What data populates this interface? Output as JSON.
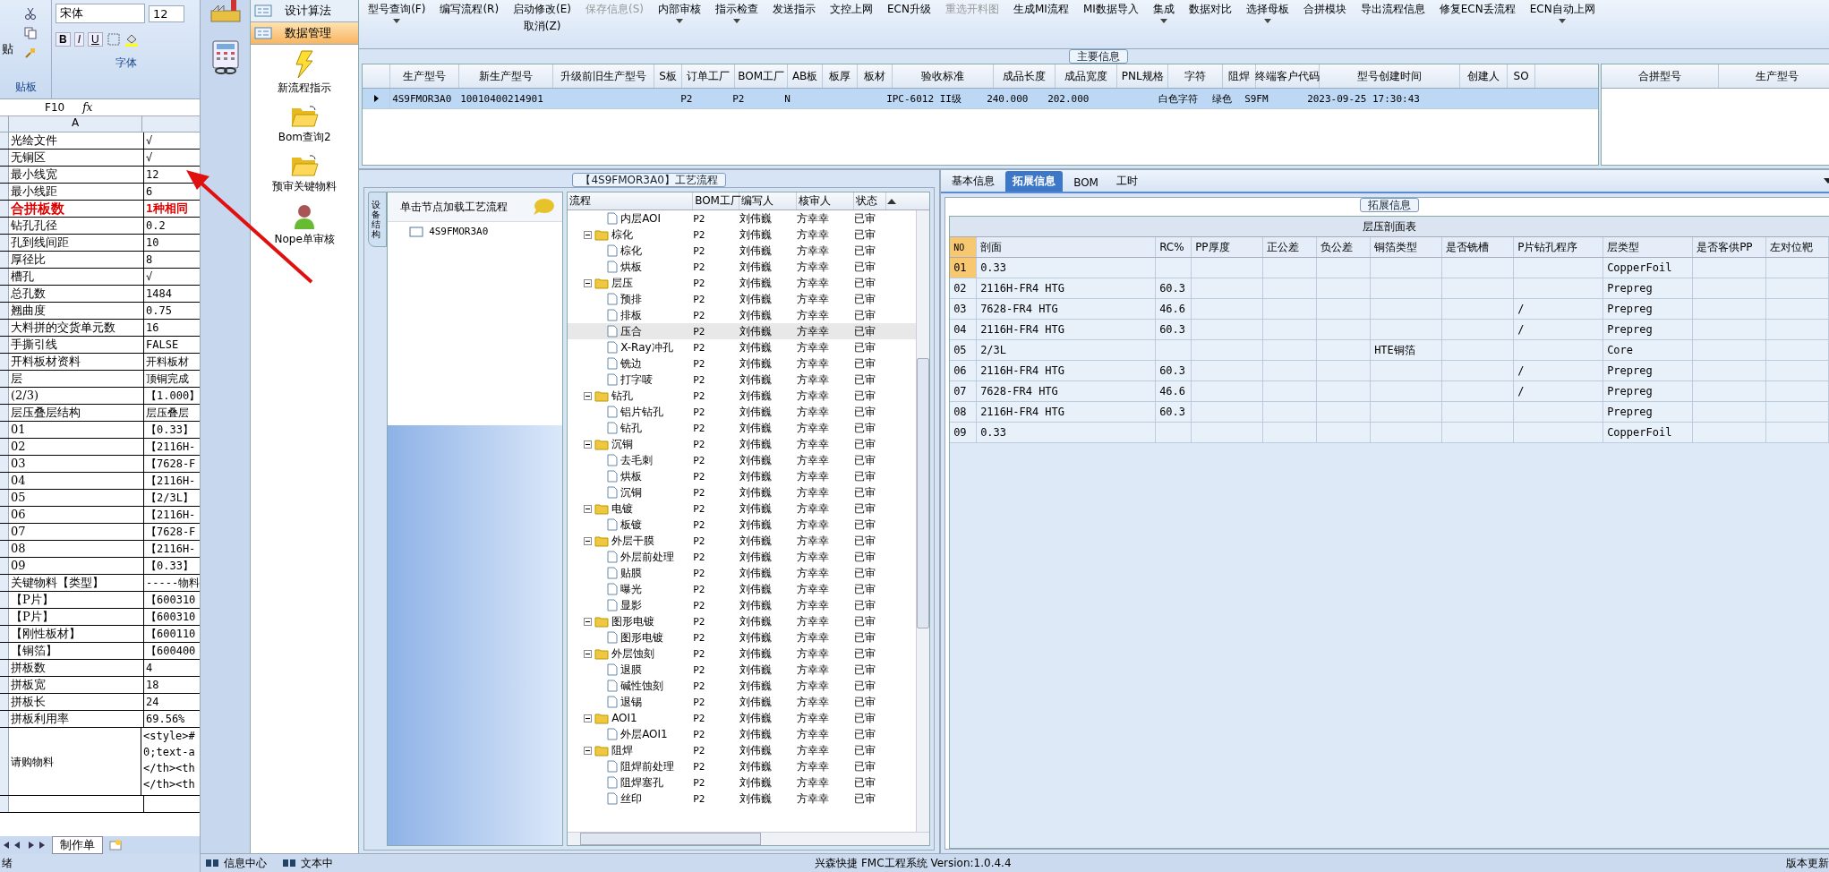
{
  "excel": {
    "paste": "贴",
    "clipboard_label": "贴板",
    "font_name": "宋体",
    "font_size": "12",
    "format_buttons": [
      "B",
      "I",
      "U"
    ],
    "font_label": "字体",
    "cell_ref": "F10",
    "fx": "fx",
    "column": "A",
    "rows": [
      {
        "label": "光绘文件",
        "value": "√",
        "emphasis": false
      },
      {
        "label": "无铜区",
        "value": "√",
        "emphasis": false
      },
      {
        "label": "最小线宽",
        "value": "12",
        "emphasis": false
      },
      {
        "label": "最小线距",
        "value": "6",
        "emphasis": false
      },
      {
        "label": "合拼板数",
        "value": "1种相同",
        "emphasis": true
      },
      {
        "label": "钻孔孔径",
        "value": "0.2",
        "emphasis": false
      },
      {
        "label": "孔到线间距",
        "value": "10",
        "emphasis": false
      },
      {
        "label": "厚径比",
        "value": "8",
        "emphasis": false
      },
      {
        "label": "槽孔",
        "value": "√",
        "emphasis": false
      },
      {
        "label": "总孔数",
        "value": "1484",
        "emphasis": false
      },
      {
        "label": "翘曲度",
        "value": "0.75",
        "emphasis": false
      },
      {
        "label": "大料拼的交货单元数",
        "value": "16",
        "emphasis": false
      },
      {
        "label": "手撕引线",
        "value": "FALSE",
        "emphasis": false
      },
      {
        "label": "开料板材资料",
        "value": "开料板材",
        "emphasis": false
      },
      {
        "label": "层",
        "value": "顶铜完成",
        "emphasis": false
      },
      {
        "label": "(2/3)",
        "value": "【1.000】",
        "emphasis": false
      },
      {
        "label": "层压叠层结构",
        "value": "层压叠层",
        "emphasis": false
      },
      {
        "label": "01",
        "value": "【0.33】",
        "emphasis": false
      },
      {
        "label": "02",
        "value": "【2116H-",
        "emphasis": false
      },
      {
        "label": "03",
        "value": "【7628-F",
        "emphasis": false
      },
      {
        "label": "04",
        "value": "【2116H-",
        "emphasis": false
      },
      {
        "label": "05",
        "value": "【2/3L】",
        "emphasis": false
      },
      {
        "label": "06",
        "value": "【2116H-",
        "emphasis": false
      },
      {
        "label": "07",
        "value": "【7628-F",
        "emphasis": false
      },
      {
        "label": "08",
        "value": "【2116H-",
        "emphasis": false
      },
      {
        "label": "09",
        "value": "【0.33】",
        "emphasis": false
      },
      {
        "label": "关键物料【类型】",
        "value": "-----物料",
        "emphasis": false
      },
      {
        "label": "【P片】",
        "value": "【600310",
        "emphasis": false
      },
      {
        "label": "【P片】",
        "value": "【600310",
        "emphasis": false
      },
      {
        "label": "【刚性板材】",
        "value": "【600110",
        "emphasis": false
      },
      {
        "label": "【铜箔】",
        "value": "【600400",
        "emphasis": false
      },
      {
        "label": "拼板数",
        "value": "4",
        "emphasis": false
      },
      {
        "label": "拼板宽",
        "value": "18",
        "emphasis": false
      },
      {
        "label": "拼板长",
        "value": "24",
        "emphasis": false
      },
      {
        "label": "拼板利用率",
        "value": "69.56%",
        "emphasis": false
      }
    ],
    "tall_row": {
      "label": "请购物料",
      "lines": [
        "<style>#",
        "0;text-a",
        "</th><th",
        "</th><th"
      ]
    },
    "sheet_tab": "制作单",
    "status": "绪"
  },
  "nav": {
    "items": [
      {
        "label": "设计算法",
        "selected": false
      },
      {
        "label": "数据管理",
        "selected": true
      }
    ],
    "tools": [
      {
        "kind": "lightning",
        "label": "新流程指示"
      },
      {
        "kind": "folder",
        "label": "Bom查询2"
      },
      {
        "kind": "folder",
        "label": "预审关键物料"
      },
      {
        "kind": "person",
        "label": "Nope单审核"
      }
    ]
  },
  "toolbar": [
    [
      {
        "label": "型号查询(F)",
        "disabled": false,
        "dropdown": true
      }
    ],
    [
      {
        "label": "编写流程(R)",
        "disabled": false,
        "dropdown": false
      }
    ],
    [
      {
        "label": "启动修改(E)",
        "disabled": false,
        "dropdown": false
      },
      {
        "label": "取消(Z)",
        "disabled": false,
        "dropdown": false
      }
    ],
    [
      {
        "label": "保存信息(S)",
        "disabled": true,
        "dropdown": false
      }
    ],
    [
      {
        "label": "内部审核",
        "disabled": false,
        "dropdown": true
      }
    ],
    [
      {
        "label": "指示检查",
        "disabled": false,
        "dropdown": true
      }
    ],
    [
      {
        "label": "发送指示",
        "disabled": false,
        "dropdown": false
      }
    ],
    [
      {
        "label": "文控上网",
        "disabled": false,
        "dropdown": false
      }
    ],
    [
      {
        "label": "ECN升级",
        "disabled": false,
        "dropdown": false
      }
    ],
    [
      {
        "label": "重选开料图",
        "disabled": true,
        "dropdown": false
      }
    ],
    [
      {
        "label": "生成MI流程",
        "disabled": false,
        "dropdown": false
      }
    ],
    [
      {
        "label": "MI数据导入",
        "disabled": false,
        "dropdown": false
      }
    ],
    [
      {
        "label": "集成",
        "disabled": false,
        "dropdown": true
      }
    ],
    [
      {
        "label": "数据对比",
        "disabled": false,
        "dropdown": false
      }
    ],
    [
      {
        "label": "选择母板",
        "disabled": false,
        "dropdown": true
      }
    ],
    [
      {
        "label": "合拼模块",
        "disabled": false,
        "dropdown": false
      }
    ],
    [
      {
        "label": "导出流程信息",
        "disabled": false,
        "dropdown": false
      }
    ],
    [
      {
        "label": "修复ECN丢流程",
        "disabled": false,
        "dropdown": false
      }
    ],
    [
      {
        "label": "ECN自动上网",
        "disabled": false,
        "dropdown": true
      }
    ]
  ],
  "main_info": {
    "title": "主要信息",
    "columns": [
      "生产型号",
      "新生产型号",
      "升级前旧生产型号",
      "S板",
      "订单工厂",
      "BOM工厂",
      "AB板",
      "板厚",
      "板材",
      "验收标准",
      "成品长度",
      "成品宽度",
      "PNL规格",
      "字符",
      "阻焊",
      "终端客户代码",
      "型号创建时间",
      "创建人",
      "SO"
    ],
    "rows": [
      {
        "selected": true,
        "cells": [
          "4S9FMOR3A0",
          "10010400214901",
          "",
          "",
          "P2",
          "P2",
          "N",
          "",
          "",
          "IPC-6012 II级",
          "240.000",
          "202.000",
          "",
          "白色字符",
          "绿色",
          "S9FM",
          "2023-09-25 17:30:43",
          "",
          ""
        ]
      }
    ],
    "merge_columns": [
      "合拼型号",
      "生产型号"
    ]
  },
  "process": {
    "title": "【4S9FMOR3A0】工艺流程",
    "side_tab": "设备结构",
    "hint": "单击节点加载工艺流程",
    "node": "4S9FMOR3A0",
    "columns": [
      "流程",
      "BOM工厂",
      "编写人",
      "核审人",
      "状态"
    ],
    "tree": [
      {
        "name": "内层AOI",
        "factory": "P2",
        "writer": "刘伟巍",
        "reviewer": "方幸幸",
        "status": "已审",
        "selected": false
      },
      {
        "name": "棕化",
        "factory": "P2",
        "writer": "刘伟巍",
        "reviewer": "方幸幸",
        "status": "已审",
        "selected": false,
        "expanded": true,
        "children": [
          {
            "name": "棕化",
            "factory": "P2",
            "writer": "刘伟巍",
            "reviewer": "方幸幸",
            "status": "已审",
            "selected": false
          },
          {
            "name": "烘板",
            "factory": "P2",
            "writer": "刘伟巍",
            "reviewer": "方幸幸",
            "status": "已审",
            "selected": false
          }
        ]
      },
      {
        "name": "层压",
        "factory": "P2",
        "writer": "刘伟巍",
        "reviewer": "方幸幸",
        "status": "已审",
        "selected": false,
        "expanded": true,
        "children": [
          {
            "name": "预排",
            "factory": "P2",
            "writer": "刘伟巍",
            "reviewer": "方幸幸",
            "status": "已审",
            "selected": false
          },
          {
            "name": "排板",
            "factory": "P2",
            "writer": "刘伟巍",
            "reviewer": "方幸幸",
            "status": "已审",
            "selected": false
          },
          {
            "name": "压合",
            "factory": "P2",
            "writer": "刘伟巍",
            "reviewer": "方幸幸",
            "status": "已审",
            "selected": true
          },
          {
            "name": "X-Ray冲孔",
            "factory": "P2",
            "writer": "刘伟巍",
            "reviewer": "方幸幸",
            "status": "已审",
            "selected": false
          },
          {
            "name": "铣边",
            "factory": "P2",
            "writer": "刘伟巍",
            "reviewer": "方幸幸",
            "status": "已审",
            "selected": false
          },
          {
            "name": "打字唛",
            "factory": "P2",
            "writer": "刘伟巍",
            "reviewer": "方幸幸",
            "status": "已审",
            "selected": false
          }
        ]
      },
      {
        "name": "钻孔",
        "factory": "P2",
        "writer": "刘伟巍",
        "reviewer": "方幸幸",
        "status": "已审",
        "selected": false,
        "expanded": true,
        "children": [
          {
            "name": "铝片钻孔",
            "factory": "P2",
            "writer": "刘伟巍",
            "reviewer": "方幸幸",
            "status": "已审",
            "selected": false
          },
          {
            "name": "钻孔",
            "factory": "P2",
            "writer": "刘伟巍",
            "reviewer": "方幸幸",
            "status": "已审",
            "selected": false
          }
        ]
      },
      {
        "name": "沉铜",
        "factory": "P2",
        "writer": "刘伟巍",
        "reviewer": "方幸幸",
        "status": "已审",
        "selected": false,
        "expanded": true,
        "children": [
          {
            "name": "去毛刺",
            "factory": "P2",
            "writer": "刘伟巍",
            "reviewer": "方幸幸",
            "status": "已审",
            "selected": false
          },
          {
            "name": "烘板",
            "factory": "P2",
            "writer": "刘伟巍",
            "reviewer": "方幸幸",
            "status": "已审",
            "selected": false
          },
          {
            "name": "沉铜",
            "factory": "P2",
            "writer": "刘伟巍",
            "reviewer": "方幸幸",
            "status": "已审",
            "selected": false
          }
        ]
      },
      {
        "name": "电镀",
        "factory": "P2",
        "writer": "刘伟巍",
        "reviewer": "方幸幸",
        "status": "已审",
        "selected": false,
        "expanded": true,
        "children": [
          {
            "name": "板镀",
            "factory": "P2",
            "writer": "刘伟巍",
            "reviewer": "方幸幸",
            "status": "已审",
            "selected": false
          }
        ]
      },
      {
        "name": "外层干膜",
        "factory": "P2",
        "writer": "刘伟巍",
        "reviewer": "方幸幸",
        "status": "已审",
        "selected": false,
        "expanded": true,
        "children": [
          {
            "name": "外层前处理",
            "factory": "P2",
            "writer": "刘伟巍",
            "reviewer": "方幸幸",
            "status": "已审",
            "selected": false
          },
          {
            "name": "贴膜",
            "factory": "P2",
            "writer": "刘伟巍",
            "reviewer": "方幸幸",
            "status": "已审",
            "selected": false
          },
          {
            "name": "曝光",
            "factory": "P2",
            "writer": "刘伟巍",
            "reviewer": "方幸幸",
            "status": "已审",
            "selected": false
          },
          {
            "name": "显影",
            "factory": "P2",
            "writer": "刘伟巍",
            "reviewer": "方幸幸",
            "status": "已审",
            "selected": false
          }
        ]
      },
      {
        "name": "图形电镀",
        "factory": "P2",
        "writer": "刘伟巍",
        "reviewer": "方幸幸",
        "status": "已审",
        "selected": false,
        "expanded": true,
        "children": [
          {
            "name": "图形电镀",
            "factory": "P2",
            "writer": "刘伟巍",
            "reviewer": "方幸幸",
            "status": "已审",
            "selected": false
          }
        ]
      },
      {
        "name": "外层蚀刻",
        "factory": "P2",
        "writer": "刘伟巍",
        "reviewer": "方幸幸",
        "status": "已审",
        "selected": false,
        "expanded": true,
        "children": [
          {
            "name": "退膜",
            "factory": "P2",
            "writer": "刘伟巍",
            "reviewer": "方幸幸",
            "status": "已审",
            "selected": false
          },
          {
            "name": "碱性蚀刻",
            "factory": "P2",
            "writer": "刘伟巍",
            "reviewer": "方幸幸",
            "status": "已审",
            "selected": false
          },
          {
            "name": "退锡",
            "factory": "P2",
            "writer": "刘伟巍",
            "reviewer": "方幸幸",
            "status": "已审",
            "selected": false
          }
        ]
      },
      {
        "name": "AOI1",
        "factory": "P2",
        "writer": "刘伟巍",
        "reviewer": "方幸幸",
        "status": "已审",
        "selected": false,
        "expanded": true,
        "children": [
          {
            "name": "外层AOI1",
            "factory": "P2",
            "writer": "刘伟巍",
            "reviewer": "方幸幸",
            "status": "已审",
            "selected": false
          }
        ]
      },
      {
        "name": "阻焊",
        "factory": "P2",
        "writer": "刘伟巍",
        "reviewer": "方幸幸",
        "status": "已审",
        "selected": false,
        "expanded": true,
        "children": [
          {
            "name": "阻焊前处理",
            "factory": "P2",
            "writer": "刘伟巍",
            "reviewer": "方幸幸",
            "status": "已审",
            "selected": false
          },
          {
            "name": "阻焊塞孔",
            "factory": "P2",
            "writer": "刘伟巍",
            "reviewer": "方幸幸",
            "status": "已审",
            "selected": false
          },
          {
            "name": "丝印",
            "factory": "P2",
            "writer": "刘伟巍",
            "reviewer": "方幸幸",
            "status": "已审",
            "selected": false
          }
        ]
      }
    ]
  },
  "detail": {
    "tabs": [
      {
        "label": "基本信息",
        "selected": false
      },
      {
        "label": "拓展信息",
        "selected": true
      },
      {
        "label": "BOM",
        "selected": false
      },
      {
        "label": "工时",
        "selected": false
      }
    ],
    "group_title": "拓展信息",
    "table_title": "层压剖面表",
    "columns": [
      "NO",
      "剖面",
      "RC%",
      "PP厚度",
      "正公差",
      "负公差",
      "铜箔类型",
      "是否铣槽",
      "P片钻孔程序",
      "层类型",
      "是否客供PP",
      "左对位靶"
    ],
    "rows": [
      {
        "selected": true,
        "cells": [
          "01",
          "0.33",
          "",
          "",
          "",
          "",
          "",
          "",
          "",
          "CopperFoil",
          "",
          ""
        ]
      },
      {
        "selected": false,
        "cells": [
          "02",
          "2116H-FR4 HTG",
          "60.3",
          "",
          "",
          "",
          "",
          "",
          "",
          "Prepreg",
          "",
          ""
        ]
      },
      {
        "selected": false,
        "cells": [
          "03",
          "7628-FR4 HTG",
          "46.6",
          "",
          "",
          "",
          "",
          "",
          "/",
          "Prepreg",
          "",
          ""
        ]
      },
      {
        "selected": false,
        "cells": [
          "04",
          "2116H-FR4 HTG",
          "60.3",
          "",
          "",
          "",
          "",
          "",
          "/",
          "Prepreg",
          "",
          ""
        ]
      },
      {
        "selected": false,
        "cells": [
          "05",
          "2/3L",
          "",
          "",
          "",
          "",
          "HTE铜箔",
          "",
          "",
          "Core",
          "",
          ""
        ]
      },
      {
        "selected": false,
        "cells": [
          "06",
          "2116H-FR4 HTG",
          "60.3",
          "",
          "",
          "",
          "",
          "",
          "/",
          "Prepreg",
          "",
          ""
        ]
      },
      {
        "selected": false,
        "cells": [
          "07",
          "7628-FR4 HTG",
          "46.6",
          "",
          "",
          "",
          "",
          "",
          "/",
          "Prepreg",
          "",
          ""
        ]
      },
      {
        "selected": false,
        "cells": [
          "08",
          "2116H-FR4 HTG",
          "60.3",
          "",
          "",
          "",
          "",
          "",
          "",
          "Prepreg",
          "",
          ""
        ]
      },
      {
        "selected": false,
        "cells": [
          "09",
          "0.33",
          "",
          "",
          "",
          "",
          "",
          "",
          "",
          "CopperFoil",
          "",
          ""
        ]
      }
    ]
  },
  "status_bar": {
    "left": [
      "信息中心",
      "文本中"
    ],
    "center": "兴森快捷 FMC工程系统 Version:1.0.4.4",
    "right": "版本更新"
  }
}
